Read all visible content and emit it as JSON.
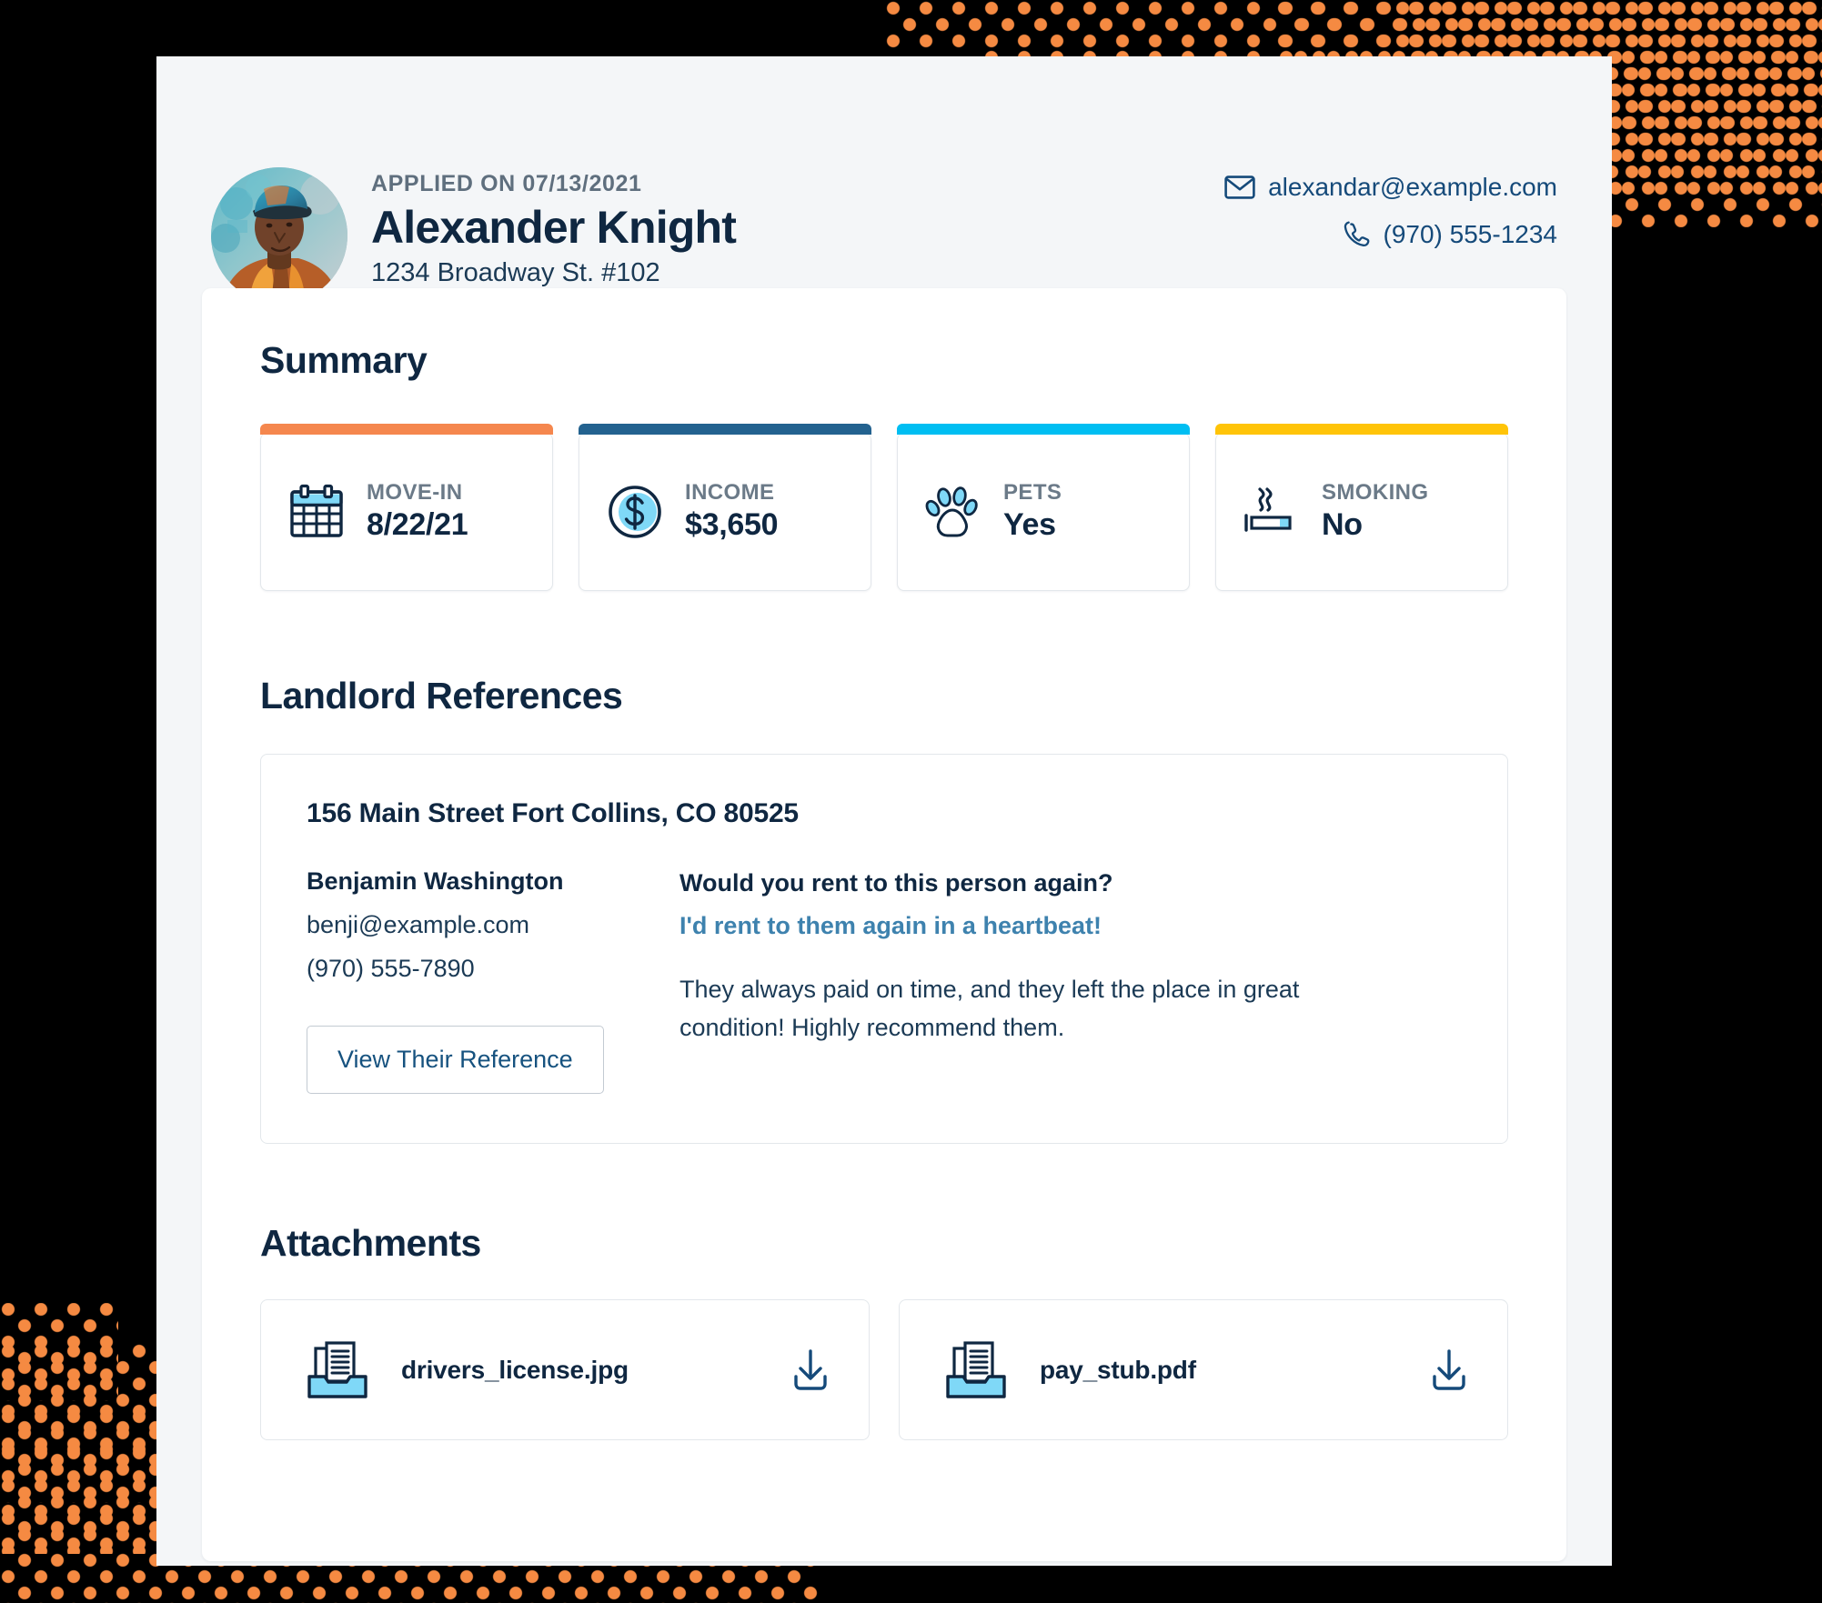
{
  "header": {
    "applied_on": "APPLIED ON 07/13/2021",
    "name": "Alexander Knight",
    "address": "1234 Broadway St. #102",
    "email": "alexandar@example.com",
    "phone": "(970) 555-1234",
    "email_icon": "envelope-icon",
    "phone_icon": "phone-icon",
    "avatar_icon": "applicant-avatar"
  },
  "summary": {
    "title": "Summary",
    "cards": [
      {
        "label": "MOVE-IN",
        "value": "8/22/21",
        "accent": "#F5874E",
        "icon": "calendar-icon"
      },
      {
        "label": "INCOME",
        "value": "$3,650",
        "accent": "#23628F",
        "icon": "dollar-coin-icon"
      },
      {
        "label": "PETS",
        "value": "Yes",
        "accent": "#00BEF2",
        "icon": "paw-print-icon"
      },
      {
        "label": "SMOKING",
        "value": "No",
        "accent": "#FFC408",
        "icon": "cigarette-icon"
      }
    ]
  },
  "references": {
    "title": "Landlord References",
    "items": [
      {
        "address": "156 Main Street Fort Collins, CO 80525",
        "name": "Benjamin Washington",
        "email": "benji@example.com",
        "phone": "(970) 555-7890",
        "button_label": "View Their Reference",
        "question": "Would you rent to this person again?",
        "answer": "I'd rent to them again in a heartbeat!",
        "comment": "They always paid on time, and they left the place in great condition! Highly recommend them."
      }
    ]
  },
  "attachments": {
    "title": "Attachments",
    "items": [
      {
        "filename": "drivers_license.jpg",
        "file_icon": "document-tray-icon",
        "download_icon": "download-icon"
      },
      {
        "filename": "pay_stub.pdf",
        "file_icon": "document-tray-icon",
        "download_icon": "download-icon"
      }
    ]
  },
  "theme": {
    "page_background": "#F4F6F8",
    "card_background": "#FFFFFF",
    "text_dark": "#0F2741",
    "text_muted": "#6B7A88",
    "link_blue": "#16527F",
    "accent_orange": "#F5874E",
    "accent_blue": "#23628F",
    "accent_cyan": "#00BEF2",
    "accent_yellow": "#FFC408",
    "dot_pattern_color": "#F58A42",
    "backdrop": "#000000"
  }
}
